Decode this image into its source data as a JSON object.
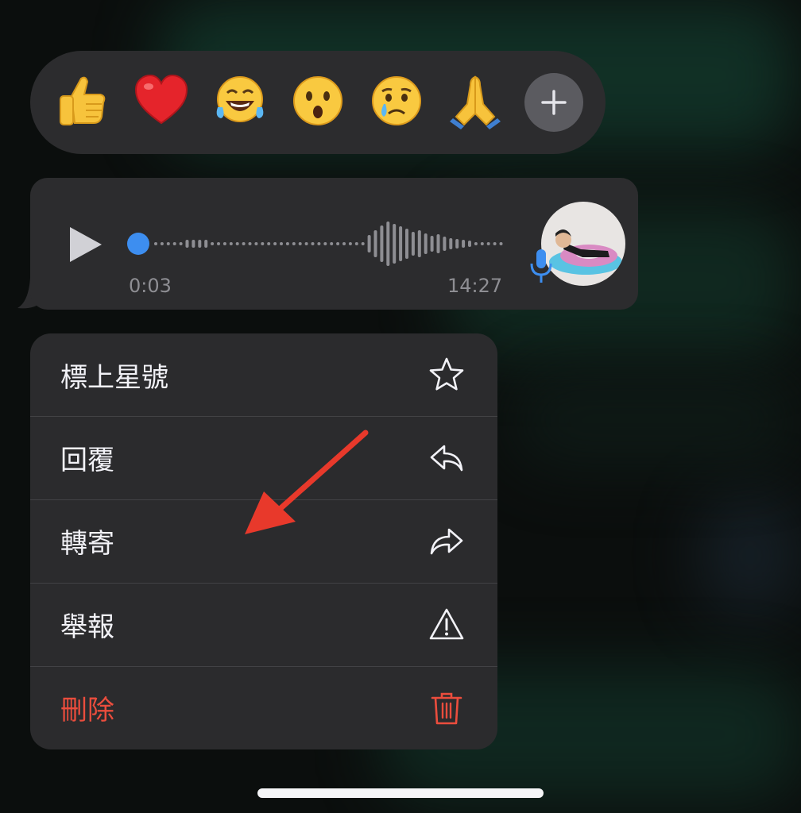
{
  "reactions": {
    "emojis": [
      "thumbs-up",
      "red-heart",
      "tears-of-joy",
      "surprised-face",
      "crying-face",
      "folded-hands"
    ],
    "more_icon": "plus-icon"
  },
  "voice_message": {
    "elapsed": "0:03",
    "sent_time": "14:27",
    "accent_color": "#3d8ef0"
  },
  "menu": {
    "items": [
      {
        "label": "標上星號",
        "icon": "star-icon"
      },
      {
        "label": "回覆",
        "icon": "reply-icon"
      },
      {
        "label": "轉寄",
        "icon": "forward-icon"
      },
      {
        "label": "舉報",
        "icon": "warning-icon"
      },
      {
        "label": "刪除",
        "icon": "trash-icon",
        "color": "#eb4d3d"
      }
    ]
  },
  "annotation_color": "#e8392b"
}
